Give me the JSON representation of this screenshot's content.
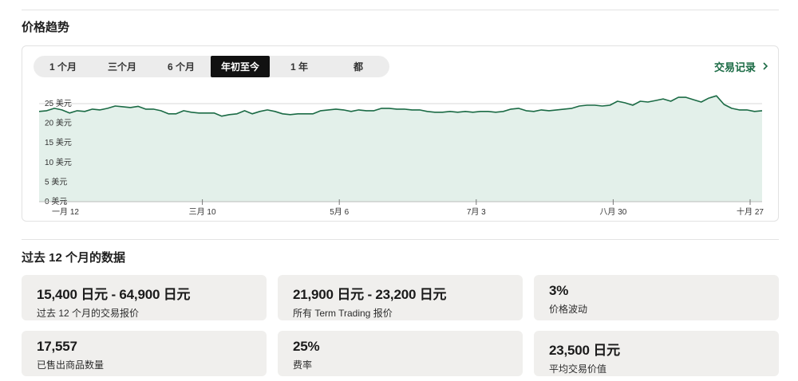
{
  "price_trend": {
    "title": "价格趋势",
    "tabs": [
      {
        "label": "1 个月",
        "active": false
      },
      {
        "label": "三个月",
        "active": false
      },
      {
        "label": "6 个月",
        "active": false
      },
      {
        "label": "年初至今",
        "active": true
      },
      {
        "label": "1 年",
        "active": false
      },
      {
        "label": "都",
        "active": false
      }
    ],
    "record_link": "交易记录",
    "chevron_icon": "chevron-right-icon"
  },
  "chart_data": {
    "type": "area",
    "y_tick_labels": [
      "25 美元",
      "20 美元",
      "15 美元",
      "10 美元",
      "5 美元",
      "0 美元"
    ],
    "y_ticks": [
      25,
      20,
      15,
      10,
      5,
      0
    ],
    "ylim": [
      0,
      25
    ],
    "x_tick_labels": [
      "一月 12",
      "三月 10",
      "5月 6",
      "7月 3",
      "八月 30",
      "十月 27"
    ],
    "grid": true,
    "line_color": "#1b6b45",
    "fill_color": "#e3f0ea",
    "values": [
      23.0,
      23.2,
      23.8,
      23.4,
      22.6,
      23.2,
      23.0,
      23.6,
      23.4,
      23.8,
      24.4,
      24.2,
      24.0,
      24.3,
      23.6,
      23.6,
      23.2,
      22.4,
      22.4,
      23.2,
      22.8,
      22.6,
      22.6,
      22.6,
      21.8,
      22.2,
      22.4,
      23.2,
      22.4,
      23.0,
      23.4,
      23.0,
      22.4,
      22.2,
      22.4,
      22.4,
      22.4,
      23.2,
      23.4,
      23.6,
      23.4,
      23.0,
      23.4,
      23.2,
      23.2,
      23.8,
      23.8,
      23.6,
      23.6,
      23.4,
      23.4,
      23.0,
      22.8,
      22.8,
      23.0,
      22.8,
      23.0,
      22.8,
      23.0,
      23.0,
      22.8,
      23.0,
      23.6,
      23.8,
      23.2,
      23.0,
      23.4,
      23.2,
      23.4,
      23.6,
      23.8,
      24.4,
      24.6,
      24.6,
      24.4,
      24.6,
      25.6,
      25.2,
      24.6,
      25.6,
      25.4,
      25.8,
      26.2,
      25.6,
      26.6,
      26.6,
      26.0,
      25.4,
      26.4,
      27.0,
      24.8,
      23.8,
      23.4,
      23.4,
      23.0,
      23.2
    ]
  },
  "past12": {
    "title": "过去 12 个月的数据",
    "stats": [
      {
        "value": "15,400 日元 - 64,900 日元",
        "label": "过去 12 个月的交易报价"
      },
      {
        "value": "21,900 日元 - 23,200 日元",
        "label": "所有 Term Trading 报价"
      },
      {
        "value": "3%",
        "label": "价格波动"
      },
      {
        "value": "17,557",
        "label": "已售出商品数量"
      },
      {
        "value": "25%",
        "label": "费率"
      },
      {
        "value": "23,500 日元",
        "label": "平均交易价值"
      }
    ]
  }
}
